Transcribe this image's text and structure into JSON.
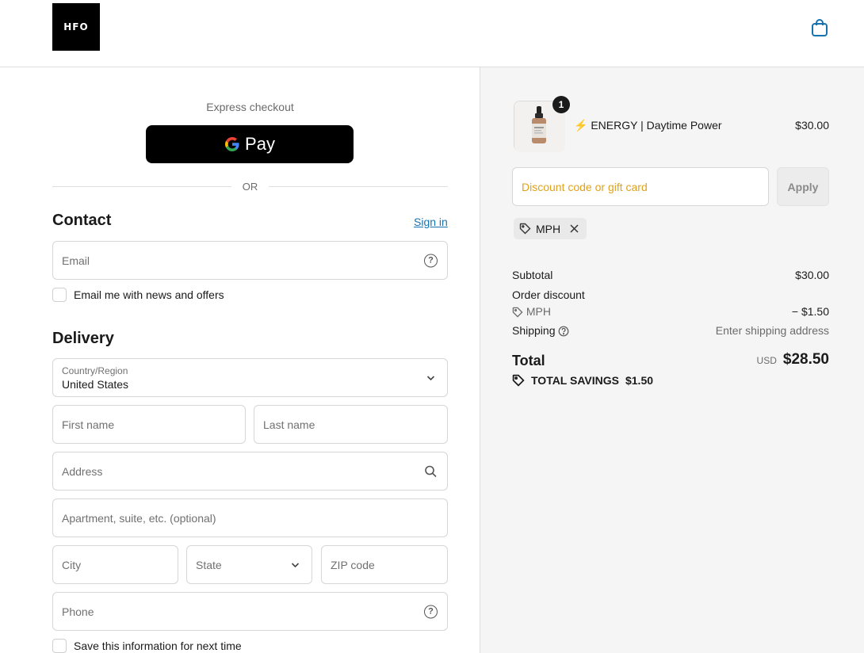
{
  "header": {
    "logo_text": "HFO",
    "cart_icon": "shopping-bag-icon"
  },
  "express": {
    "label": "Express checkout",
    "gpay_label": "Pay",
    "or_label": "OR"
  },
  "contact": {
    "title": "Contact",
    "signin_label": "Sign in",
    "email_placeholder": "Email",
    "news_label": "Email me with news and offers"
  },
  "delivery": {
    "title": "Delivery",
    "country_label": "Country/Region",
    "country_value": "United States",
    "first_name_placeholder": "First name",
    "last_name_placeholder": "Last name",
    "address_placeholder": "Address",
    "apartment_placeholder": "Apartment, suite, etc. (optional)",
    "city_placeholder": "City",
    "state_placeholder": "State",
    "zip_placeholder": "ZIP code",
    "phone_placeholder": "Phone",
    "save_label": "Save this information for next time"
  },
  "order": {
    "item": {
      "quantity": "1",
      "name": "⚡ ENERGY | Daytime Power",
      "price": "$30.00"
    },
    "discount_placeholder": "Discount code or gift card",
    "apply_label": "Apply",
    "applied_code": "MPH",
    "subtotal_label": "Subtotal",
    "subtotal_value": "$30.00",
    "order_discount_label": "Order discount",
    "discount_code": "MPH",
    "discount_value": "− $1.50",
    "shipping_label": "Shipping",
    "shipping_value": "Enter shipping address",
    "total_label": "Total",
    "total_currency": "USD",
    "total_value": "$28.50",
    "savings_label": "TOTAL SAVINGS",
    "savings_value": "$1.50"
  },
  "colors": {
    "accent_link": "#1773b0",
    "discount_placeholder": "#e0a21b",
    "summary_bg": "#f5f5f5"
  }
}
